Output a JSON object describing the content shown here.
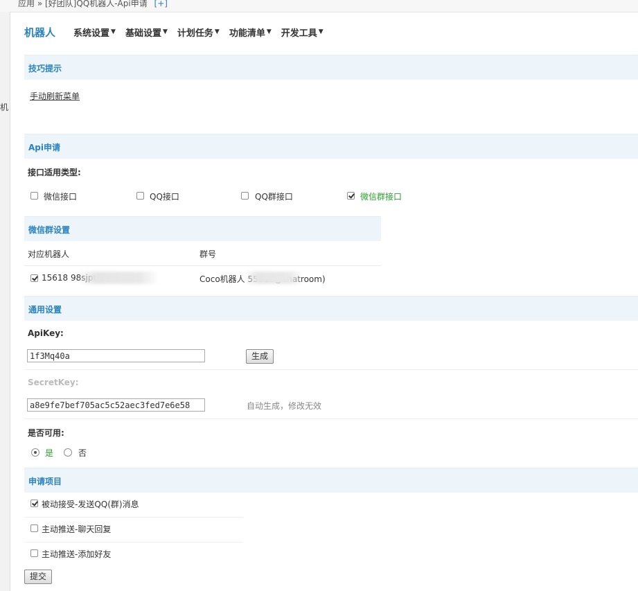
{
  "breadcrumb": {
    "text": "应用 » [好团队]QQ机器人-Api申请",
    "plus": "[+]"
  },
  "left_strip": {
    "text": "机"
  },
  "nav": {
    "brand": "机器人",
    "items": [
      {
        "label": "系统设置"
      },
      {
        "label": "基础设置"
      },
      {
        "label": "计划任务"
      },
      {
        "label": "功能清单"
      },
      {
        "label": "开发工具"
      }
    ],
    "caret": "▼"
  },
  "tips": {
    "title": "技巧提示",
    "link": "手动刷新菜单"
  },
  "api": {
    "title": "Api申请",
    "type_label": "接口适用类型:",
    "types": [
      {
        "label": "微信接口",
        "checked": false
      },
      {
        "label": "QQ接口",
        "checked": false
      },
      {
        "label": "QQ群接口",
        "checked": false
      },
      {
        "label": "微信群接口",
        "checked": true
      }
    ]
  },
  "wechat_group": {
    "title": "微信群设置",
    "headers": [
      "对应机器人",
      "群号"
    ],
    "row": {
      "robot": "15618        98sjpt12)",
      "group": "Coco机器人          55516@chatroom)",
      "checked": true
    }
  },
  "general": {
    "title": "通用设置",
    "apikey_label": "ApiKey:",
    "apikey_value": "1f3Mq40a",
    "generate_btn": "生成",
    "secret_label": "SecretKey:",
    "secret_value": "a8e9fe7bef705ac5c52aec3fed7e6e58",
    "secret_hint": "自动生成，修改无效",
    "enabled_label": "是否可用:",
    "yes": "是",
    "no": "否"
  },
  "project": {
    "title": "申请项目",
    "items": [
      {
        "label": "被动接受-发送QQ(群)消息",
        "checked": true
      },
      {
        "label": "主动推送-聊天回复",
        "checked": false
      },
      {
        "label": "主动推送-添加好友",
        "checked": false
      }
    ],
    "submit": "提交"
  },
  "colors": {
    "accent": "#2a83c0",
    "section_bg": "#edf4fa",
    "checked_green": "#2aa12a"
  }
}
